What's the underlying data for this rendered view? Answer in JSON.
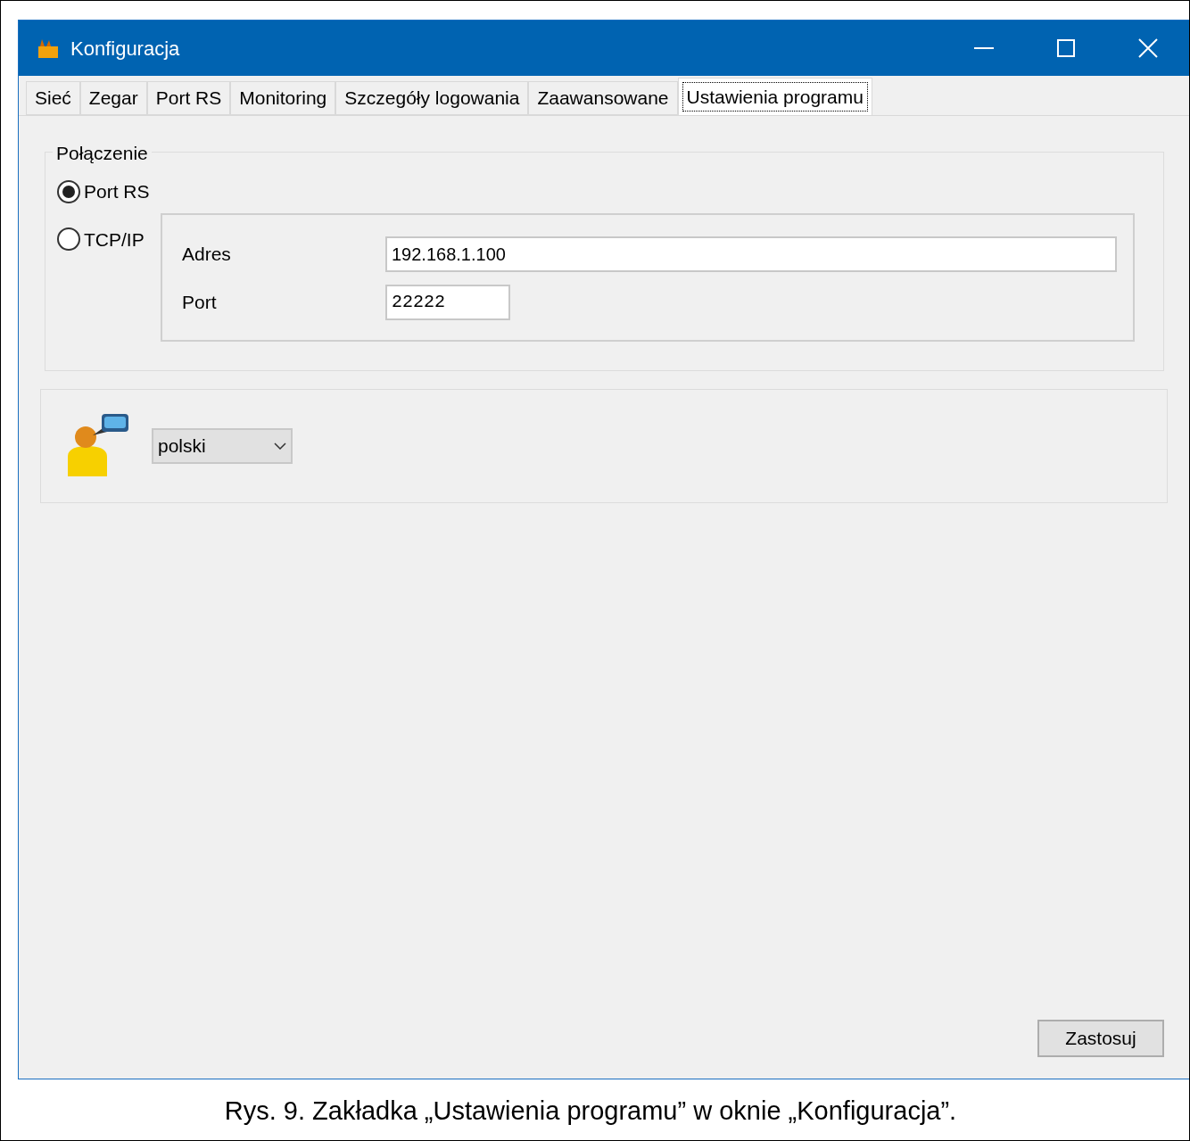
{
  "window": {
    "title": "Konfiguracja"
  },
  "tabs": [
    {
      "label": "Sieć",
      "selected": false
    },
    {
      "label": "Zegar",
      "selected": false
    },
    {
      "label": "Port RS",
      "selected": false
    },
    {
      "label": "Monitoring",
      "selected": false
    },
    {
      "label": "Szczegóły logowania",
      "selected": false
    },
    {
      "label": "Zaawansowane",
      "selected": false
    },
    {
      "label": "Ustawienia programu",
      "selected": true
    }
  ],
  "connection": {
    "title": "Połączenie",
    "options": [
      {
        "label": "Port RS",
        "selected": true
      },
      {
        "label": "TCP/IP",
        "selected": false
      }
    ],
    "fields": [
      {
        "label": "Adres",
        "value": "192.168.1.100"
      },
      {
        "label": "Port",
        "value": "22222"
      }
    ]
  },
  "language": {
    "value": "polski"
  },
  "apply_button": "Zastosuj",
  "caption": "Rys. 9. Zakładka „Ustawienia programu” w oknie „Konfiguracja”."
}
